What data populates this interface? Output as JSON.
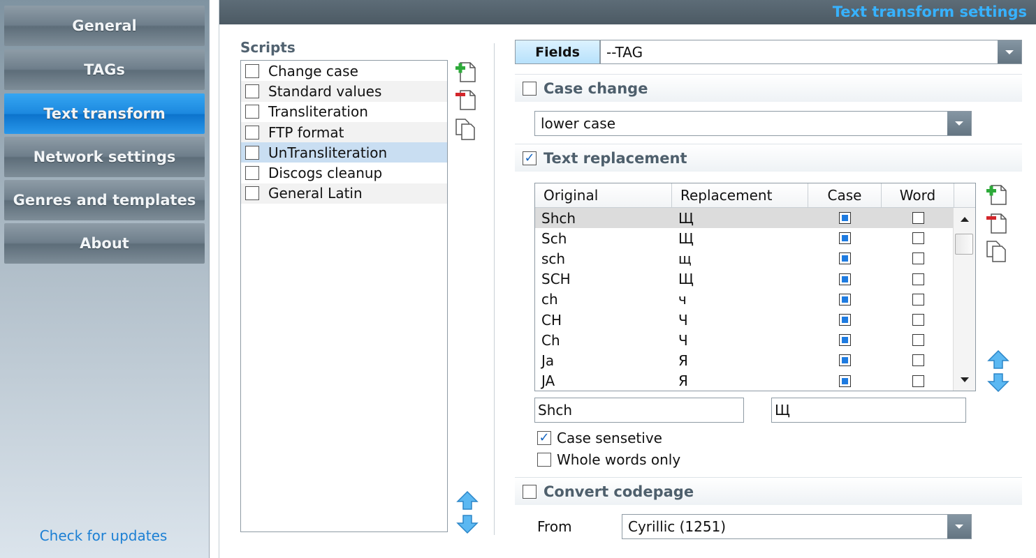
{
  "sidebar": {
    "items": [
      {
        "label": "General",
        "active": false
      },
      {
        "label": "TAGs",
        "active": false
      },
      {
        "label": "Text transform",
        "active": true
      },
      {
        "label": "Network settings",
        "active": false
      },
      {
        "label": "Genres and templates",
        "active": false
      },
      {
        "label": "About",
        "active": false
      }
    ],
    "check_updates": "Check for updates"
  },
  "header": {
    "title": "Text transform settings"
  },
  "scripts": {
    "label": "Scripts",
    "items": [
      {
        "label": "Change case",
        "checked": false
      },
      {
        "label": "Standard values",
        "checked": false
      },
      {
        "label": "Transliteration",
        "checked": false
      },
      {
        "label": "FTP format",
        "checked": false
      },
      {
        "label": "UnTransliteration",
        "checked": false,
        "selected": true
      },
      {
        "label": "Discogs cleanup",
        "checked": false
      },
      {
        "label": "General Latin",
        "checked": false
      }
    ]
  },
  "fields": {
    "label": "Fields",
    "value": "--TAG"
  },
  "case_change": {
    "label": "Case change",
    "checked": false,
    "value": "lower case"
  },
  "text_replacement": {
    "label": "Text replacement",
    "checked": true,
    "columns": [
      "Original",
      "Replacement",
      "Case",
      "Word"
    ],
    "rows": [
      [
        "Shch",
        "Щ",
        true,
        false
      ],
      [
        "Sch",
        "Щ",
        true,
        false
      ],
      [
        "sch",
        "щ",
        true,
        false
      ],
      [
        "SCH",
        "Щ",
        true,
        false
      ],
      [
        "ch",
        "ч",
        true,
        false
      ],
      [
        "CH",
        "Ч",
        true,
        false
      ],
      [
        "Ch",
        "Ч",
        true,
        false
      ],
      [
        "Ja",
        "Я",
        true,
        false
      ],
      [
        "JA",
        "Я",
        true,
        false
      ]
    ],
    "original_input": "Shch",
    "replacement_input": "Щ",
    "case_sensitive": {
      "label": "Case sensetive",
      "checked": true
    },
    "whole_words": {
      "label": "Whole words only",
      "checked": false
    }
  },
  "convert_codepage": {
    "label": "Convert codepage",
    "checked": false,
    "from_label": "From",
    "from_value": "Cyrillic (1251)"
  },
  "colors": {
    "accent": "#1c88df",
    "title_text": "#37b2ff",
    "header_bar": "#4c5a64"
  }
}
